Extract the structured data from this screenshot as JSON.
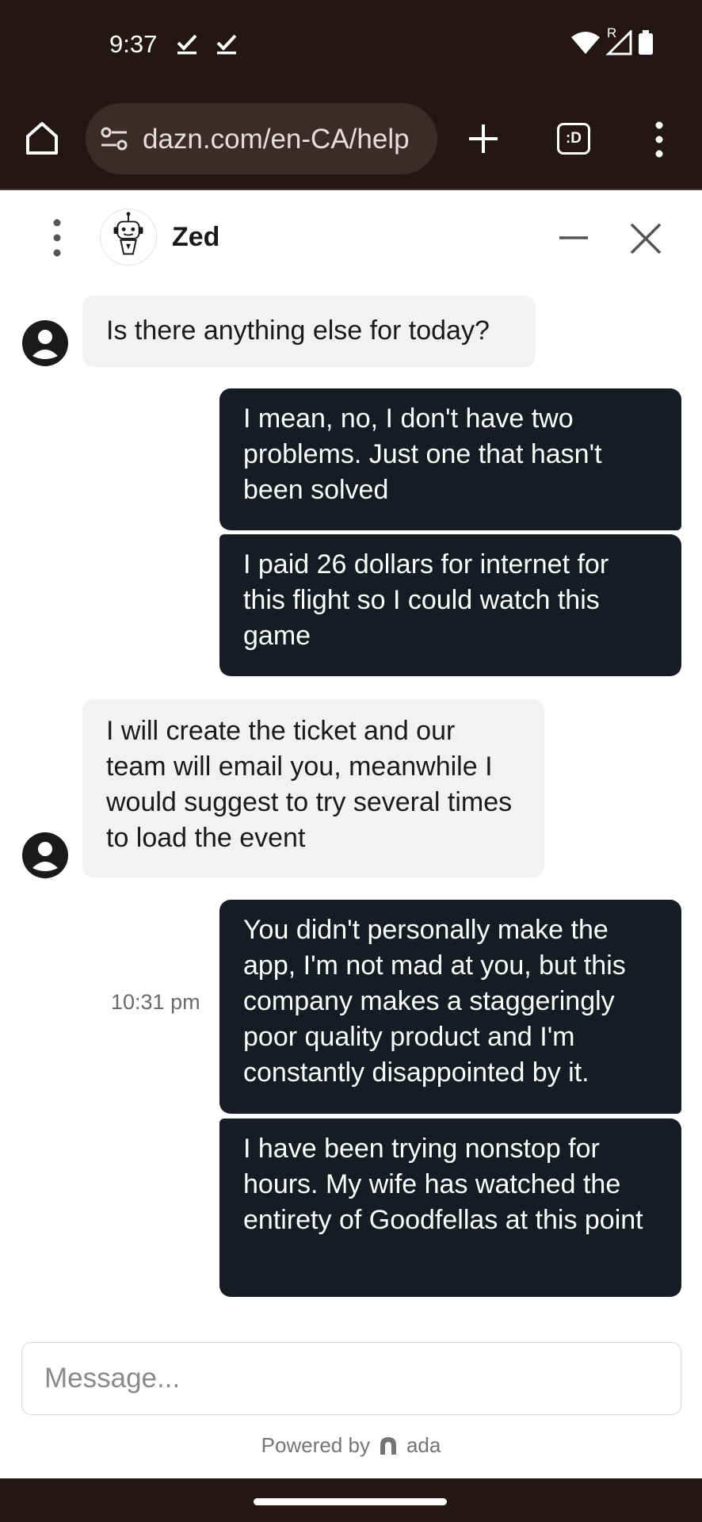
{
  "status_bar": {
    "time": "9:37",
    "roaming_indicator": "R",
    "icons": [
      "check-icon",
      "check-icon",
      "wifi-icon",
      "signal-icon",
      "battery-icon"
    ]
  },
  "browser": {
    "url": "dazn.com/en-CA/help",
    "tab_count_label": ":D",
    "icons": [
      "home-icon",
      "tune-icon",
      "plus-icon",
      "tabs-icon",
      "more-vert-icon"
    ]
  },
  "chat": {
    "bot_name": "Zed",
    "bot_avatar_icon": "robot-icon",
    "agent_avatar_icon": "account-circle-icon",
    "messages": [
      {
        "sender": "agent",
        "text": "Is there anything else for today?"
      },
      {
        "sender": "user",
        "text": "I mean, no, I don't have two problems. Just one that hasn't been solved"
      },
      {
        "sender": "user",
        "text": "I paid 26 dollars for internet for this flight so I could watch this game"
      },
      {
        "sender": "agent",
        "text": "I will create the ticket and our team will email you, meanwhile I would suggest to try several times to load the event"
      },
      {
        "sender": "user",
        "text": "You didn't personally make the app, I'm not mad at you, but this company makes a staggeringly poor quality product and I'm constantly disappointed by it."
      },
      {
        "sender": "user",
        "text": "I have been trying nonstop for hours. My wife has watched the entirety of Goodfellas at this point"
      }
    ],
    "timestamp": "10:31 pm"
  },
  "composer": {
    "placeholder": "Message...",
    "powered_by": "Powered by",
    "brand": "ada"
  },
  "colors": {
    "chrome_bg": "#231615",
    "url_bg": "#3b2c2a",
    "user_bubble": "#161b24",
    "agent_bubble": "#f2f2f2"
  }
}
